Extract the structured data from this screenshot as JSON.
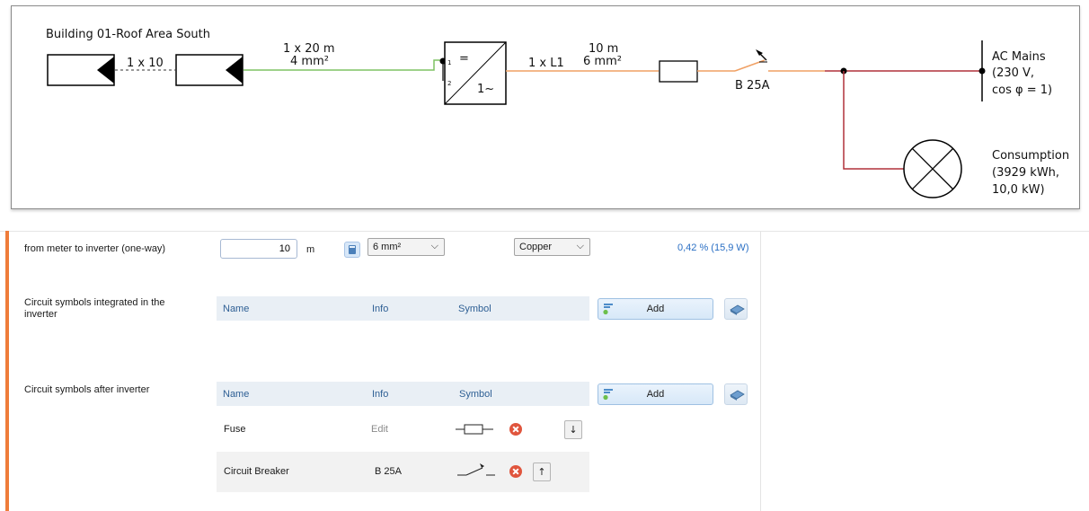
{
  "schematic": {
    "building_label": "Building 01-Roof Area South",
    "module_count": "1 x 10",
    "dc_cable_length": "1 x 20 m",
    "dc_cable_size": "4 mm²",
    "inverter_dc_symbol": "=",
    "inverter_ac_symbol": "1~",
    "inverter_pin1": "1",
    "inverter_pin2": "2",
    "ac_phase": "1 x L1",
    "ac_cable_length": "10 m",
    "ac_cable_size": "6 mm²",
    "breaker_rating": "B 25A",
    "mains_title": "AC Mains",
    "mains_voltage": "(230 V,",
    "mains_cosphi": "cos φ = 1)",
    "consumption_title": "Consumption",
    "consumption_energy": "(3929 kWh,",
    "consumption_power": "10,0 kW)",
    "colors": {
      "dc_line": "#7ec263",
      "ac_line": "#f0a064",
      "mains_line": "#b0303a"
    }
  },
  "cable_row": {
    "label": "from meter to inverter (one-way)",
    "length_value": "10",
    "length_unit": "m",
    "cross_section": "6 mm²",
    "material": "Copper",
    "loss": "0,42 % (15,9 W)"
  },
  "integrated_section": {
    "label": "Circuit symbols integrated in the inverter",
    "columns": [
      "Name",
      "Info",
      "Symbol"
    ],
    "add_label": "Add"
  },
  "after_section": {
    "label": "Circuit symbols after inverter",
    "columns": [
      "Name",
      "Info",
      "Symbol"
    ],
    "add_label": "Add",
    "rows": [
      {
        "name": "Fuse",
        "info": "Edit",
        "move": "↓"
      },
      {
        "name": "Circuit Breaker",
        "info": "B 25A",
        "move": "↑"
      }
    ]
  },
  "accent_color": "#ef7c3a"
}
